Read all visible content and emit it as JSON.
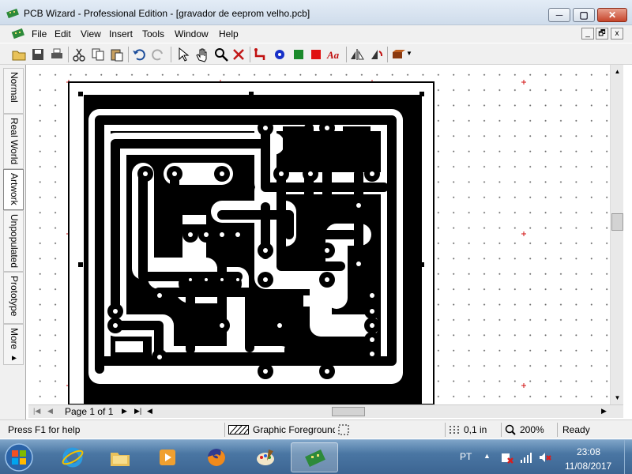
{
  "window": {
    "title": "PCB Wizard - Professional Edition - [gravador de eeprom velho.pcb]",
    "controls": {
      "minimize": "─",
      "maximize": "▢",
      "close": "✕"
    }
  },
  "menu": {
    "items": [
      "File",
      "Edit",
      "View",
      "Insert",
      "Tools",
      "Window",
      "Help"
    ],
    "mdi_controls": [
      "_",
      "🗗",
      "x"
    ]
  },
  "toolbar": {
    "icons": [
      "open-folder-icon",
      "save-icon",
      "print-icon",
      "cut-icon",
      "copy-icon",
      "paste-icon",
      "undo-icon",
      "redo-icon",
      "select-arrow-icon",
      "pan-hand-icon",
      "zoom-icon",
      "delete-icon",
      "track-icon",
      "pad-round-icon",
      "rectangle-icon",
      "filled-rectangle-icon",
      "text-icon",
      "flip-icon",
      "rotate-icon",
      "component-icon"
    ],
    "text_tool": "Aa"
  },
  "sidebar": {
    "tabs": [
      {
        "label": "Normal",
        "active": false
      },
      {
        "label": "Real World",
        "active": false
      },
      {
        "label": "Artwork",
        "active": true
      },
      {
        "label": "Unpopulated",
        "active": false
      },
      {
        "label": "Prototype",
        "active": false
      },
      {
        "label": "More ▸",
        "active": false
      }
    ]
  },
  "navigator": {
    "page_label": "Page 1 of 1"
  },
  "status": {
    "help": "Press F1 for help",
    "layer": "Graphic Foreground",
    "grid": "0,1 in",
    "zoom": "200%",
    "state": "Ready"
  },
  "taskbar": {
    "apps": [
      "start-orb",
      "internet-explorer",
      "file-explorer",
      "media-player",
      "firefox",
      "paint",
      "pcb-wizard"
    ],
    "language": "PT",
    "time": "23:08",
    "date": "11/08/2017"
  },
  "colors": {
    "board": "#000000",
    "accent_red": "#d21010",
    "tab_active": "#ffffff"
  }
}
